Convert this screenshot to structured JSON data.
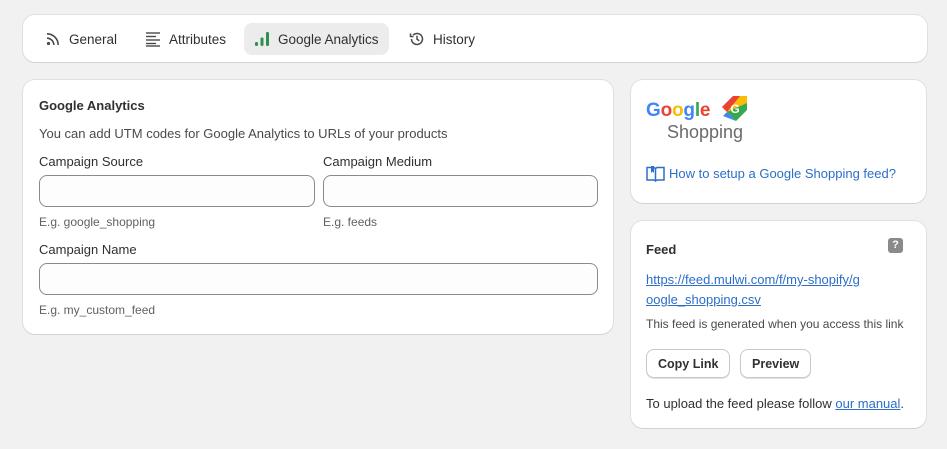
{
  "tabs": [
    {
      "label": "General",
      "icon": "rss-icon"
    },
    {
      "label": "Attributes",
      "icon": "list-lines-icon"
    },
    {
      "label": "Google Analytics",
      "icon": "bar-chart-icon",
      "active": true
    },
    {
      "label": "History",
      "icon": "history-clock-icon"
    }
  ],
  "analytics": {
    "title": "Google Analytics",
    "description": "You can add UTM codes for Google Analytics to URLs of your products",
    "campaign_source": {
      "label": "Campaign Source",
      "value": "",
      "hint": "E.g. google_shopping"
    },
    "campaign_medium": {
      "label": "Campaign Medium",
      "value": "",
      "hint": "E.g. feeds"
    },
    "campaign_name": {
      "label": "Campaign Name",
      "value": "",
      "hint": "E.g. my_custom_feed"
    }
  },
  "google_shopping": {
    "logo_google": "Google",
    "logo_shopping": "Shopping",
    "help_link": "How to setup a Google Shopping feed?"
  },
  "feed": {
    "title": "Feed",
    "help_icon": "?",
    "url": "https://feed.mulwi.com/f/my-shopify/google_shopping.csv",
    "note": "This feed is generated when you access this link",
    "copy_button": "Copy Link",
    "preview_button": "Preview",
    "footer_prefix": "To upload the feed please follow ",
    "footer_link": "our manual",
    "footer_suffix": "."
  },
  "colors": {
    "link": "#2c6ecb",
    "active_tab_bg": "#ececec",
    "analytics_icon": "#2f8f4e",
    "google_blue": "#4285f4",
    "google_red": "#ea4335",
    "google_yellow": "#fbbc05",
    "google_green": "#34a853"
  }
}
